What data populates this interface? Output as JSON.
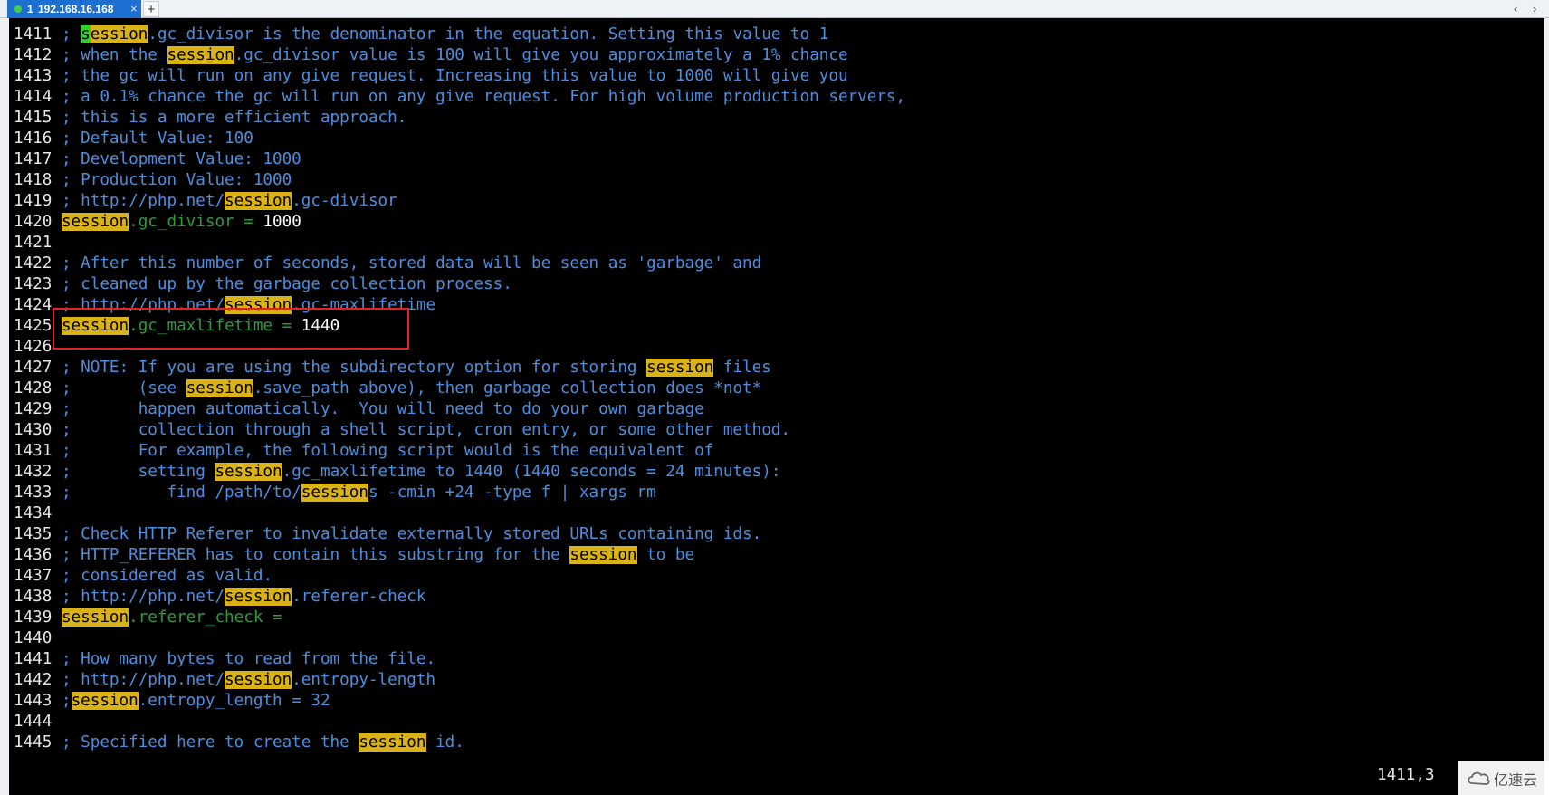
{
  "tab": {
    "number": "1",
    "title": "192.168.16.168",
    "close_glyph": "×",
    "add_glyph": "+",
    "scroll_left_glyph": "‹",
    "scroll_right_glyph": "›",
    "status_color": "#3fd13f",
    "accent_color": "#1d6fd1"
  },
  "colors": {
    "background": "#000000",
    "comment": "#4c8fe0",
    "key": "#2e9a3c",
    "value": "#ffffff",
    "search_highlight": "#d8b216",
    "cursor": "#2fd12f",
    "annotation_box": "#e02424"
  },
  "lines": [
    {
      "n": "1411",
      "parts": [
        {
          "t": "; ",
          "c": "c"
        },
        {
          "t": "s",
          "c": "cur"
        },
        {
          "t": "ession",
          "c": "hl"
        },
        {
          "t": ".gc_divisor is the denominator in the equation. Setting this value to 1",
          "c": "c"
        }
      ]
    },
    {
      "n": "1412",
      "parts": [
        {
          "t": "; when the ",
          "c": "c"
        },
        {
          "t": "session",
          "c": "hl"
        },
        {
          "t": ".gc_divisor value is 100 will give you approximately a 1% chance",
          "c": "c"
        }
      ]
    },
    {
      "n": "1413",
      "parts": [
        {
          "t": "; the gc will run on any give request. Increasing this value to 1000 will give you",
          "c": "c"
        }
      ]
    },
    {
      "n": "1414",
      "parts": [
        {
          "t": "; a 0.1% chance the gc will run on any give request. For high volume production servers,",
          "c": "c"
        }
      ]
    },
    {
      "n": "1415",
      "parts": [
        {
          "t": "; this is a more efficient approach.",
          "c": "c"
        }
      ]
    },
    {
      "n": "1416",
      "parts": [
        {
          "t": "; Default Value: 100",
          "c": "c"
        }
      ]
    },
    {
      "n": "1417",
      "parts": [
        {
          "t": "; Development Value: 1000",
          "c": "c"
        }
      ]
    },
    {
      "n": "1418",
      "parts": [
        {
          "t": "; Production Value: 1000",
          "c": "c"
        }
      ]
    },
    {
      "n": "1419",
      "parts": [
        {
          "t": "; http://php.net/",
          "c": "c"
        },
        {
          "t": "session",
          "c": "hl"
        },
        {
          "t": ".gc-divisor",
          "c": "c"
        }
      ]
    },
    {
      "n": "1420",
      "parts": [
        {
          "t": "session",
          "c": "hl"
        },
        {
          "t": ".gc_divisor = ",
          "c": "k"
        },
        {
          "t": "1000",
          "c": "v"
        }
      ]
    },
    {
      "n": "1421",
      "parts": []
    },
    {
      "n": "1422",
      "parts": [
        {
          "t": "; After this number of seconds, stored data will be seen as 'garbage' and",
          "c": "c"
        }
      ]
    },
    {
      "n": "1423",
      "parts": [
        {
          "t": "; cleaned up by the garbage collection process.",
          "c": "c"
        }
      ]
    },
    {
      "n": "1424",
      "parts": [
        {
          "t": "; http://php.net/",
          "c": "c"
        },
        {
          "t": "session",
          "c": "hl"
        },
        {
          "t": ".gc-maxlifetime",
          "c": "c"
        }
      ]
    },
    {
      "n": "1425",
      "parts": [
        {
          "t": "session",
          "c": "hl"
        },
        {
          "t": ".gc_maxlifetime = ",
          "c": "k"
        },
        {
          "t": "1440",
          "c": "v"
        }
      ]
    },
    {
      "n": "1426",
      "parts": []
    },
    {
      "n": "1427",
      "parts": [
        {
          "t": "; NOTE: If you are using the subdirectory option for storing ",
          "c": "c"
        },
        {
          "t": "session",
          "c": "hl"
        },
        {
          "t": " files",
          "c": "c"
        }
      ]
    },
    {
      "n": "1428",
      "parts": [
        {
          "t": ";       (see ",
          "c": "c"
        },
        {
          "t": "session",
          "c": "hl"
        },
        {
          "t": ".save_path above), then garbage collection does *not*",
          "c": "c"
        }
      ]
    },
    {
      "n": "1429",
      "parts": [
        {
          "t": ";       happen automatically.  You will need to do your own garbage",
          "c": "c"
        }
      ]
    },
    {
      "n": "1430",
      "parts": [
        {
          "t": ";       collection through a shell script, cron entry, or some other method.",
          "c": "c"
        }
      ]
    },
    {
      "n": "1431",
      "parts": [
        {
          "t": ";       For example, the following script would is the equivalent of",
          "c": "c"
        }
      ]
    },
    {
      "n": "1432",
      "parts": [
        {
          "t": ";       setting ",
          "c": "c"
        },
        {
          "t": "session",
          "c": "hl"
        },
        {
          "t": ".gc_maxlifetime to 1440 (1440 seconds = 24 minutes):",
          "c": "c"
        }
      ]
    },
    {
      "n": "1433",
      "parts": [
        {
          "t": ";          find /path/to/",
          "c": "c"
        },
        {
          "t": "session",
          "c": "hl"
        },
        {
          "t": "s -cmin +24 -type f | xargs rm",
          "c": "c"
        }
      ]
    },
    {
      "n": "1434",
      "parts": []
    },
    {
      "n": "1435",
      "parts": [
        {
          "t": "; Check HTTP Referer to invalidate externally stored URLs containing ids.",
          "c": "c"
        }
      ]
    },
    {
      "n": "1436",
      "parts": [
        {
          "t": "; HTTP_REFERER has to contain this substring for the ",
          "c": "c"
        },
        {
          "t": "session",
          "c": "hl"
        },
        {
          "t": " to be",
          "c": "c"
        }
      ]
    },
    {
      "n": "1437",
      "parts": [
        {
          "t": "; considered as valid.",
          "c": "c"
        }
      ]
    },
    {
      "n": "1438",
      "parts": [
        {
          "t": "; http://php.net/",
          "c": "c"
        },
        {
          "t": "session",
          "c": "hl"
        },
        {
          "t": ".referer-check",
          "c": "c"
        }
      ]
    },
    {
      "n": "1439",
      "parts": [
        {
          "t": "session",
          "c": "hl"
        },
        {
          "t": ".referer_check =",
          "c": "k"
        }
      ]
    },
    {
      "n": "1440",
      "parts": []
    },
    {
      "n": "1441",
      "parts": [
        {
          "t": "; How many bytes to read from the file.",
          "c": "c"
        }
      ]
    },
    {
      "n": "1442",
      "parts": [
        {
          "t": "; http://php.net/",
          "c": "c"
        },
        {
          "t": "session",
          "c": "hl"
        },
        {
          "t": ".entropy-length",
          "c": "c"
        }
      ]
    },
    {
      "n": "1443",
      "parts": [
        {
          "t": ";",
          "c": "c"
        },
        {
          "t": "session",
          "c": "hl"
        },
        {
          "t": ".entropy_length = 32",
          "c": "c"
        }
      ]
    },
    {
      "n": "1444",
      "parts": []
    },
    {
      "n": "1445",
      "parts": [
        {
          "t": "; Specified here to create the ",
          "c": "c"
        },
        {
          "t": "session",
          "c": "hl"
        },
        {
          "t": " id.",
          "c": "c"
        }
      ]
    }
  ],
  "status": {
    "cursor_position": "1411,3"
  },
  "watermark": {
    "text": "亿速云",
    "icon": "cloud-logo-icon"
  }
}
